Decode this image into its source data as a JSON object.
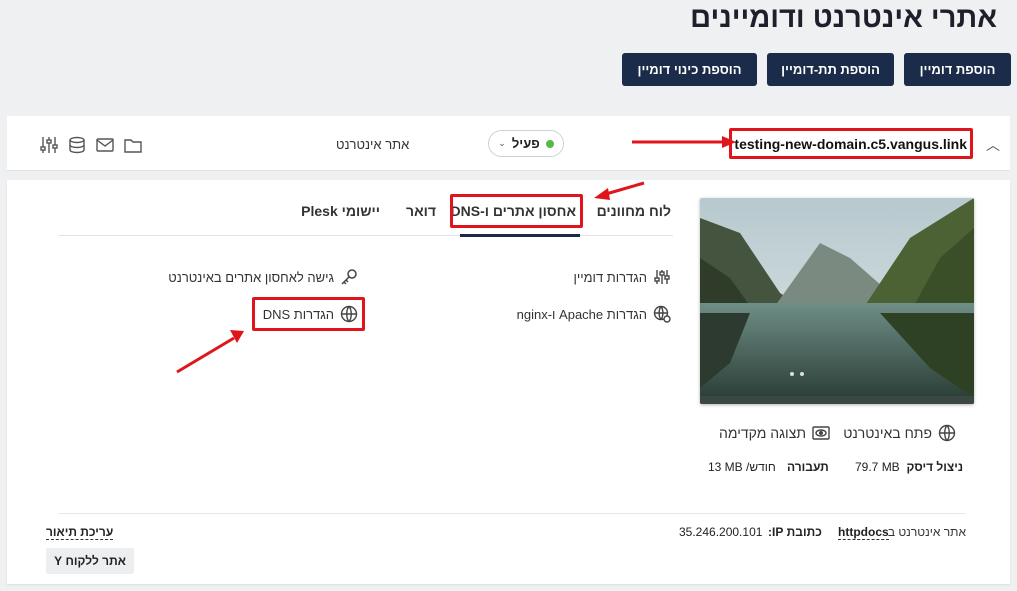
{
  "page": {
    "title": "אתרי אינטרנט ודומיינים"
  },
  "toolbar": {
    "add_domain": "הוספת דומיין",
    "add_subdomain": "הוספת תת-דומיין",
    "add_alias": "הוספת כינוי דומיין"
  },
  "domain": {
    "name": "testing-new-domain.c5.vangus.link",
    "status": "פעיל",
    "type": "אתר אינטרנט"
  },
  "tabs": [
    "לוח מחוונים",
    "אחסון אתרים ו-DNS",
    "דואר",
    "יישומי Plesk"
  ],
  "links": {
    "domain_settings": "הגדרות דומיין",
    "hosting_access": "גישה לאחסון אתרים באינטרנט",
    "apache_nginx": "הגדרות Apache ו-nginx",
    "dns_settings": "הגדרות DNS"
  },
  "preview": {
    "open_site": "פתח באינטרנט",
    "preview": "תצוגה מקדימה"
  },
  "stats": {
    "disk_label": "ניצול דיסק",
    "disk_value": "79.7 MB",
    "traffic_label": "תעבורה",
    "traffic_value": "13 MB /חודש"
  },
  "footer": {
    "site_at": "אתר אינטרנט ב-",
    "folder": "httpdocs",
    "ip_label": "כתובת IP:",
    "ip_value": "35.246.200.101",
    "edit_desc": "עריכת תיאור",
    "client_site": "אתר ללקוח Y"
  },
  "colors": {
    "primary": "#1b2b4a",
    "active_status": "#57b846",
    "annotation": "#e0151c"
  }
}
